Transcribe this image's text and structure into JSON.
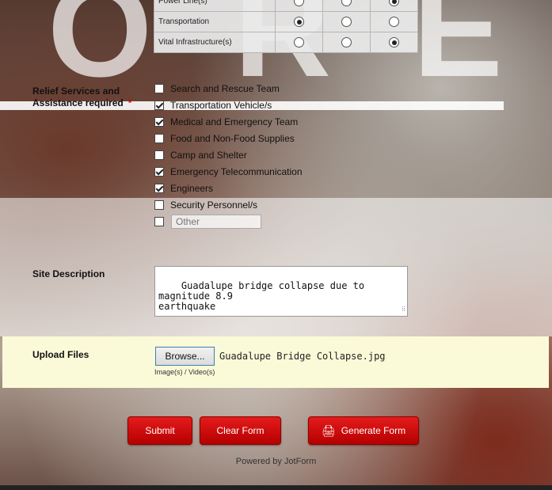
{
  "grid": {
    "rows": [
      {
        "label": "Power Line(s)",
        "selected": 2
      },
      {
        "label": "Transportation",
        "selected": 0
      },
      {
        "label": "Vital Infrastructure(s)",
        "selected": 2
      }
    ]
  },
  "relief": {
    "label_line1": "Relief Services and",
    "label_line2": "Assistance required",
    "required_mark": "*",
    "options": [
      {
        "label": "Search and Rescue Team",
        "checked": false
      },
      {
        "label": "Transportation Vehicle/s",
        "checked": true
      },
      {
        "label": "Medical and Emergency Team",
        "checked": true
      },
      {
        "label": "Food and Non-Food Supplies",
        "checked": false
      },
      {
        "label": "Camp and Shelter",
        "checked": false
      },
      {
        "label": "Emergency Telecommunication",
        "checked": true
      },
      {
        "label": "Engineers",
        "checked": true
      },
      {
        "label": "Security Personnel/s",
        "checked": false
      }
    ],
    "other_placeholder": "Other"
  },
  "site": {
    "label": "Site Description",
    "value": "Guadalupe bridge collapse due to magnitude 8.9\nearthquake"
  },
  "upload": {
    "label": "Upload Files",
    "browse_label": "Browse...",
    "filename": "Guadalupe Bridge Collapse.jpg",
    "hint": "Image(s) / Video(s)"
  },
  "buttons": {
    "submit": "Submit",
    "clear": "Clear Form",
    "generate": "Generate Form"
  },
  "powered_by": "Powered by JotForm",
  "colors": {
    "button": "#d40f0f",
    "upload_band": "#fbfad8"
  },
  "icons": {
    "print": "printer-icon"
  }
}
